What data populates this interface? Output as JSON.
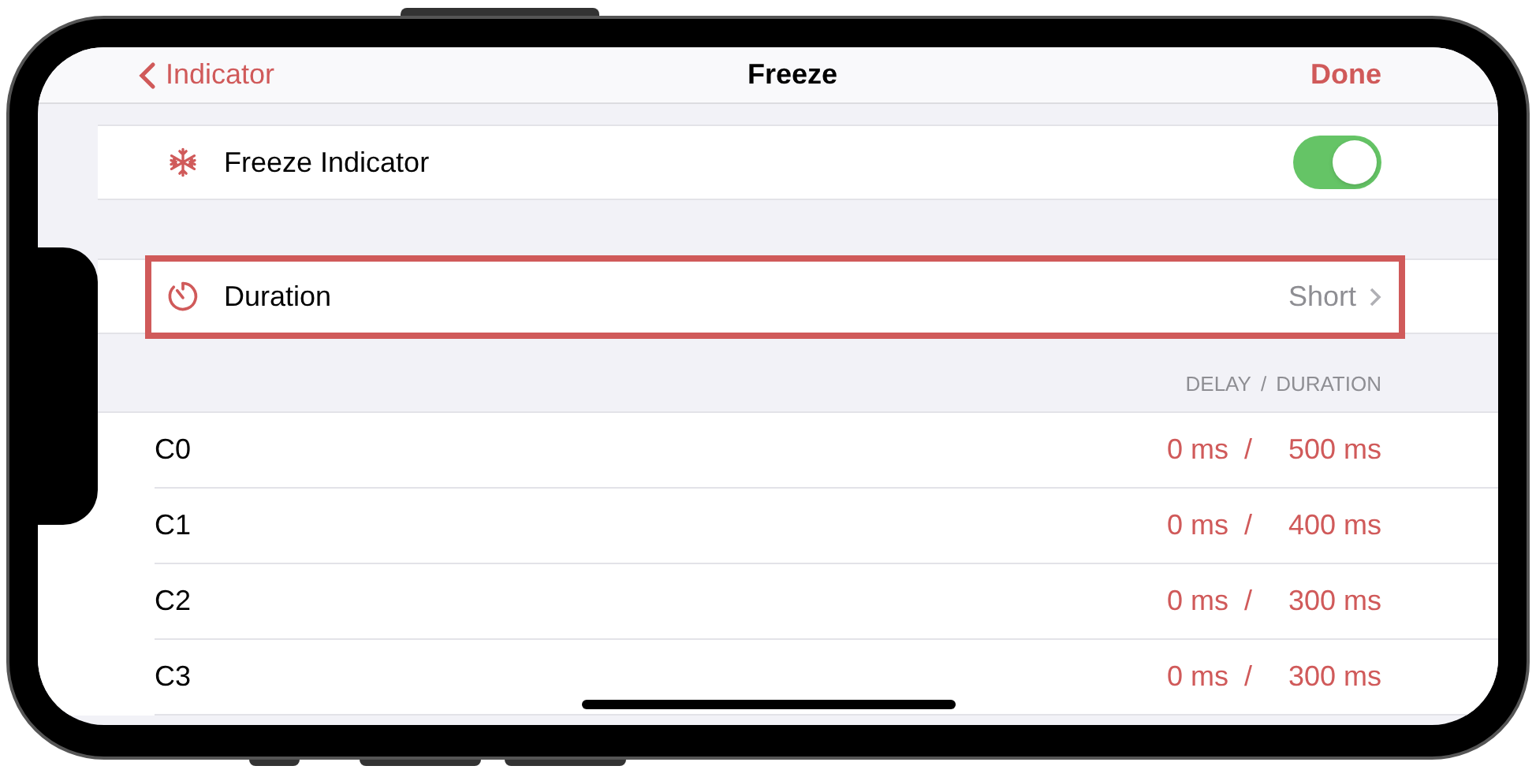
{
  "nav": {
    "back": "Indicator",
    "title": "Freeze",
    "done": "Done"
  },
  "settings": [
    {
      "kind": "toggle",
      "label": "Freeze Indicator",
      "on": true,
      "highlighted": false
    },
    {
      "kind": "disclosure",
      "label": "Duration",
      "value": "Short",
      "highlighted": true
    }
  ],
  "table": {
    "header": {
      "delay": "DELAY",
      "separator": "/",
      "duration": "DURATION"
    },
    "rows": [
      {
        "name": "C0",
        "delay": "0 ms",
        "separator": "/",
        "duration": "500 ms"
      },
      {
        "name": "C1",
        "delay": "0 ms",
        "separator": "/",
        "duration": "400 ms"
      },
      {
        "name": "C2",
        "delay": "0 ms",
        "separator": "/",
        "duration": "300 ms"
      },
      {
        "name": "C3",
        "delay": "0 ms",
        "separator": "/",
        "duration": "300 ms"
      }
    ]
  }
}
